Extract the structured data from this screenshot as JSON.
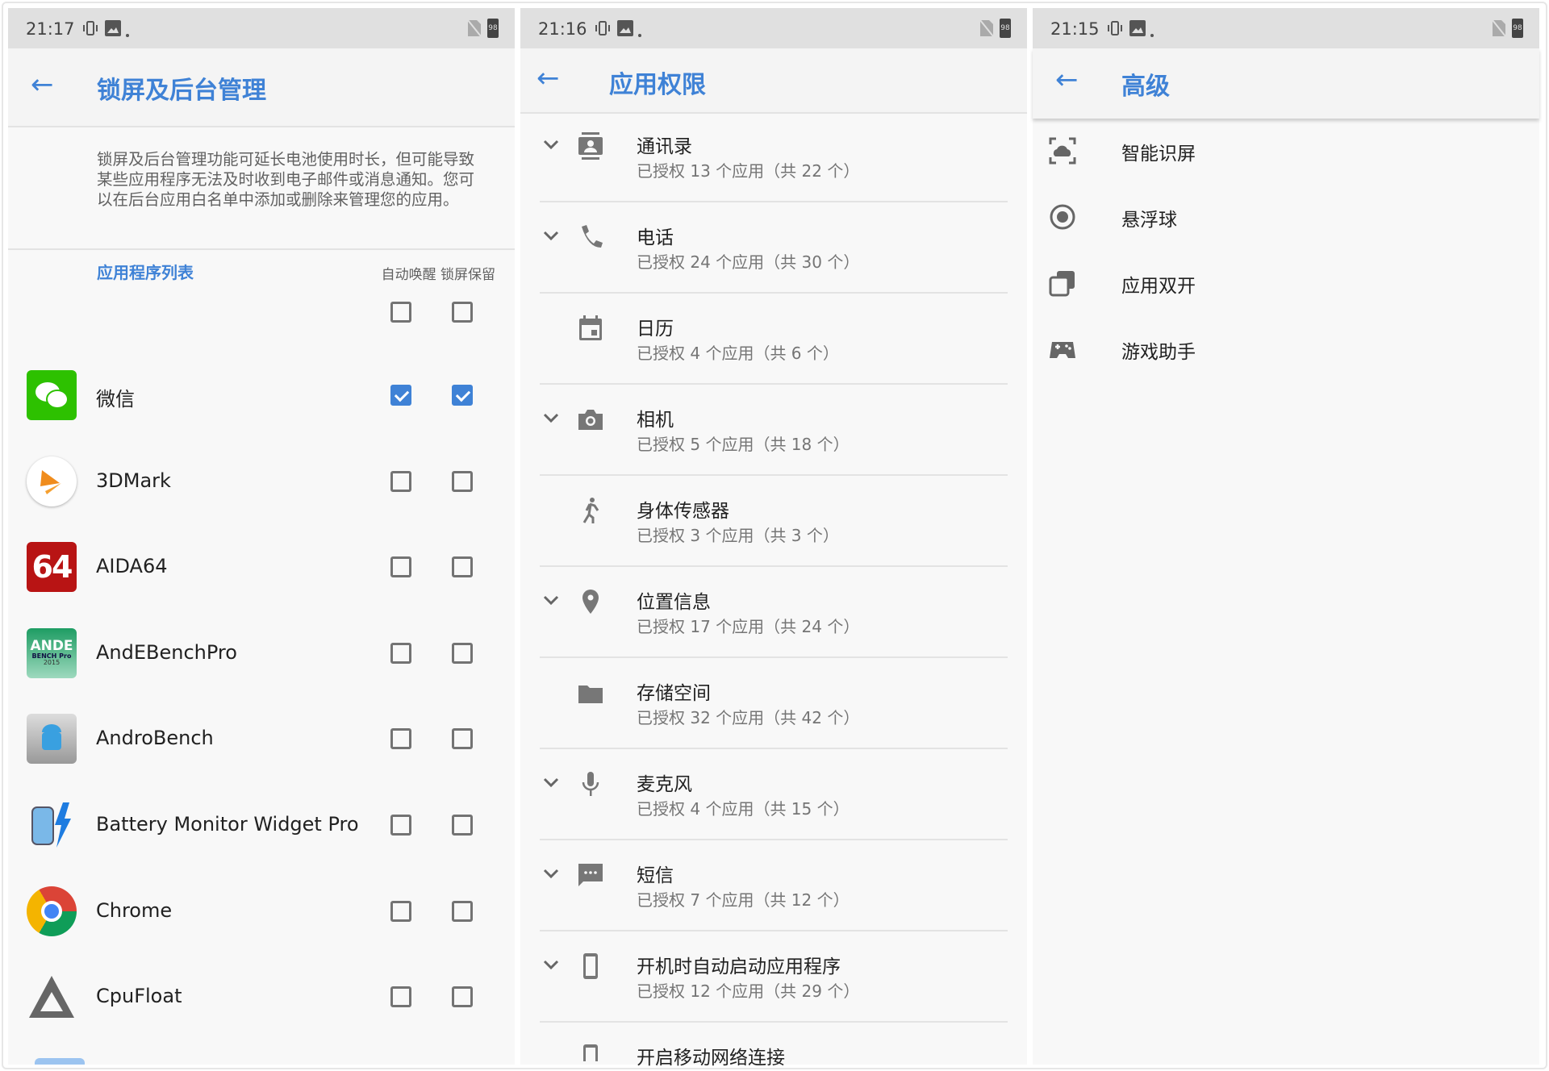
{
  "colors": {
    "accent": "#3f82d6",
    "statusbar": "#e0e0e0",
    "bg": "#f8f8f8"
  },
  "battery": "98",
  "panel1": {
    "time": "21:17",
    "title": "锁屏及后台管理",
    "description": "锁屏及后台管理功能可延长电池使用时长，但可能导致某些应用程序无法及时收到电子邮件或消息通知。您可以在后台应用白名单中添加或删除来管理您的应用。",
    "list_header": "应用程序列表",
    "col_headers": "自动唤醒 锁屏保留",
    "select_all": {
      "auto_wake": false,
      "lock_keep": false
    },
    "apps": [
      {
        "name": "微信",
        "icon": "wechat-icon",
        "auto_wake": true,
        "lock_keep": true
      },
      {
        "name": "3DMark",
        "icon": "3dmark-icon",
        "auto_wake": false,
        "lock_keep": false
      },
      {
        "name": "AIDA64",
        "icon": "aida64-icon",
        "auto_wake": false,
        "lock_keep": false
      },
      {
        "name": "AndEBenchPro",
        "icon": "andebench-icon",
        "auto_wake": false,
        "lock_keep": false
      },
      {
        "name": "AndroBench",
        "icon": "androbench-icon",
        "auto_wake": false,
        "lock_keep": false
      },
      {
        "name": "Battery Monitor Widget Pro",
        "icon": "battery-monitor-icon",
        "auto_wake": false,
        "lock_keep": false
      },
      {
        "name": "Chrome",
        "icon": "chrome-icon",
        "auto_wake": false,
        "lock_keep": false
      },
      {
        "name": "CpuFloat",
        "icon": "cpufloat-icon",
        "auto_wake": false,
        "lock_keep": false
      }
    ]
  },
  "panel2": {
    "time": "21:16",
    "title": "应用权限",
    "permissions": [
      {
        "title": "通讯录",
        "subtitle": "已授权 13 个应用（共 22 个）",
        "icon": "contacts-icon",
        "expandable": true
      },
      {
        "title": "电话",
        "subtitle": "已授权 24 个应用（共 30 个）",
        "icon": "phone-icon",
        "expandable": true
      },
      {
        "title": "日历",
        "subtitle": "已授权 4 个应用（共 6 个）",
        "icon": "calendar-icon",
        "expandable": false
      },
      {
        "title": "相机",
        "subtitle": "已授权 5 个应用（共 18 个）",
        "icon": "camera-icon",
        "expandable": true
      },
      {
        "title": "身体传感器",
        "subtitle": "已授权 3 个应用（共 3 个）",
        "icon": "body-sensor-icon",
        "expandable": false
      },
      {
        "title": "位置信息",
        "subtitle": "已授权 17 个应用（共 24 个）",
        "icon": "location-icon",
        "expandable": true
      },
      {
        "title": "存储空间",
        "subtitle": "已授权 32 个应用（共 42 个）",
        "icon": "folder-icon",
        "expandable": false
      },
      {
        "title": "麦克风",
        "subtitle": "已授权 4 个应用（共 15 个）",
        "icon": "microphone-icon",
        "expandable": true
      },
      {
        "title": "短信",
        "subtitle": "已授权 7 个应用（共 12 个）",
        "icon": "sms-icon",
        "expandable": true
      },
      {
        "title": "开机时自动启动应用程序",
        "subtitle": "已授权 12 个应用（共 29 个）",
        "icon": "device-icon",
        "expandable": true
      },
      {
        "title": "开启移动网络连接",
        "subtitle": "",
        "icon": "device-icon",
        "expandable": false
      }
    ]
  },
  "panel3": {
    "time": "21:15",
    "title": "高级",
    "items": [
      {
        "label": "智能识屏",
        "icon": "smart-screen-icon"
      },
      {
        "label": "悬浮球",
        "icon": "floating-ball-icon"
      },
      {
        "label": "应用双开",
        "icon": "dual-app-icon"
      },
      {
        "label": "游戏助手",
        "icon": "gamepad-icon"
      }
    ]
  }
}
